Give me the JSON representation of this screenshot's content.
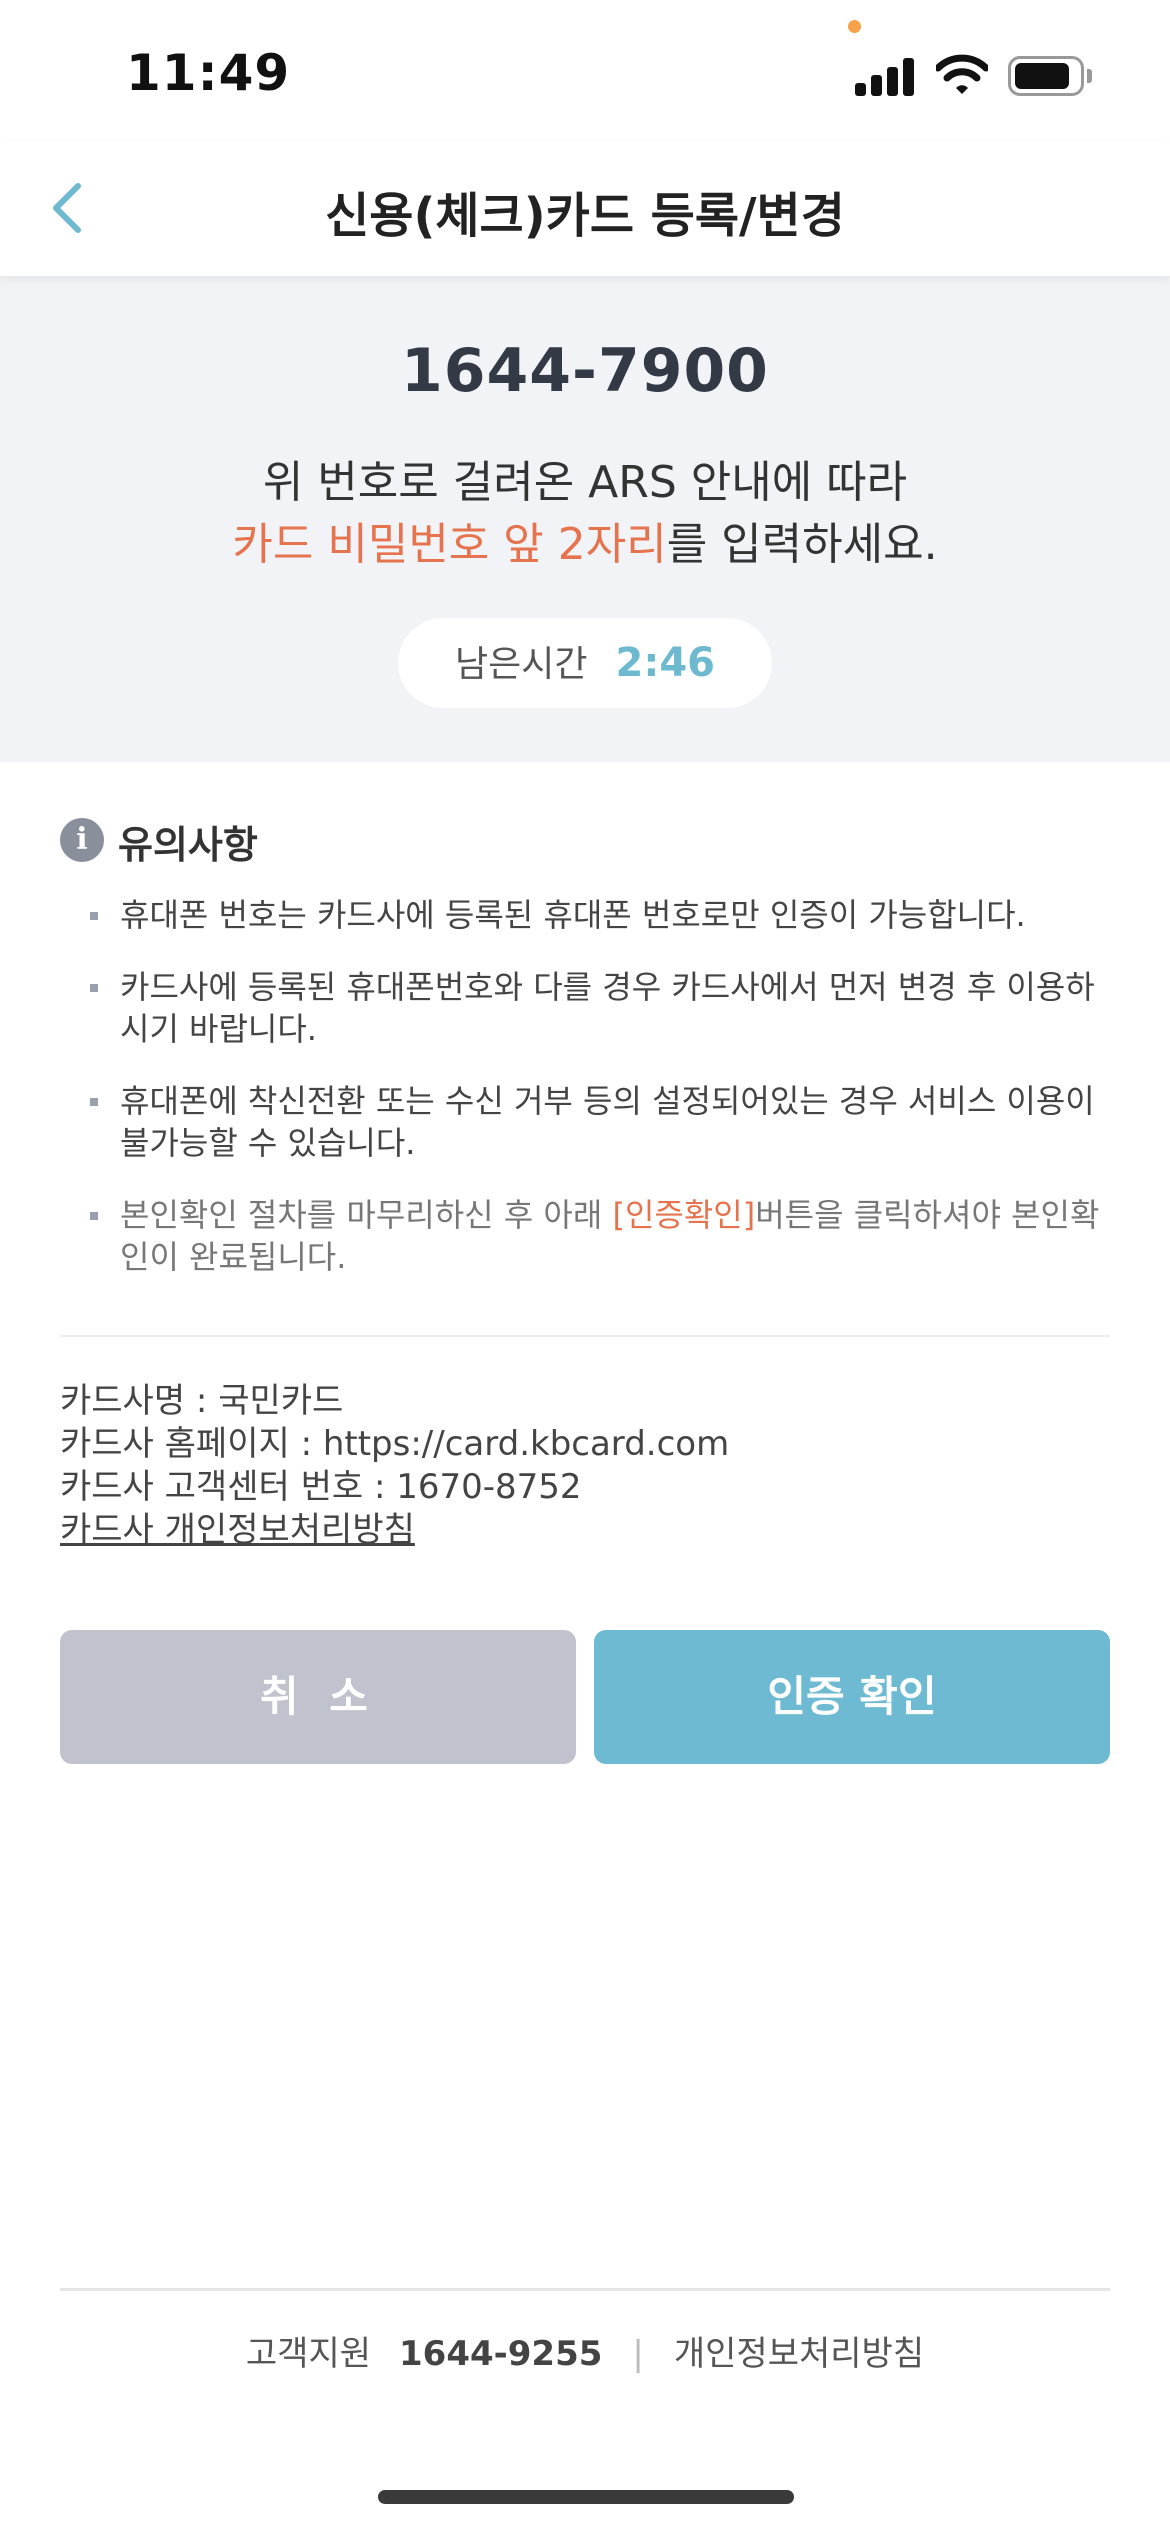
{
  "status_bar": {
    "time": "11:49",
    "signal_icon": "cellular-signal-icon",
    "wifi_icon": "wifi-icon",
    "battery_icon": "battery-icon"
  },
  "header": {
    "back_icon": "chevron-left-icon",
    "title": "신용(체크)카드 등록/변경"
  },
  "ars": {
    "number": "1644-7900",
    "instruction_line1": "위 번호로 걸려온 ARS 안내에 따라",
    "instruction_highlight": "카드 비밀번호 앞 2자리",
    "instruction_rest": "를 입력하세요.",
    "timer_label": "남은시간",
    "timer_value": "2:46"
  },
  "notice": {
    "icon": "info-icon",
    "title": "유의사항",
    "items": [
      "휴대폰 번호는 카드사에 등록된 휴대폰 번호로만 인증이 가능합니다.",
      "카드사에 등록된 휴대폰번호와 다를 경우 카드사에서 먼저 변경 후 이용하시기 바랍니다.",
      "휴대폰에 착신전환 또는 수신 거부 등의 설정되어있는 경우 서비스 이용이 불가능할 수 있습니다."
    ],
    "last_item_before": "본인확인 절차를 마무리하신 후 아래 ",
    "last_item_highlight": "[인증확인]",
    "last_item_after": "버튼을 클릭하셔야 본인확인이 완료됩니다."
  },
  "card_info": {
    "company": "카드사명 : 국민카드",
    "homepage": "카드사 홈페이지 : https://card.kbcard.com",
    "center": "카드사 고객센터 번호 : 1670-8752",
    "privacy_link": "카드사 개인정보처리방침"
  },
  "buttons": {
    "cancel": "취 소",
    "confirm": "인증 확인"
  },
  "footer": {
    "support_label": "고객지원",
    "support_phone": "1644-9255",
    "separator": "|",
    "privacy_policy": "개인정보처리방침"
  },
  "colors": {
    "accent": "#6fbad3",
    "highlight": "#e5744e",
    "panel_bg": "#f2f3f7",
    "cancel_bg": "#c0c3cd"
  }
}
